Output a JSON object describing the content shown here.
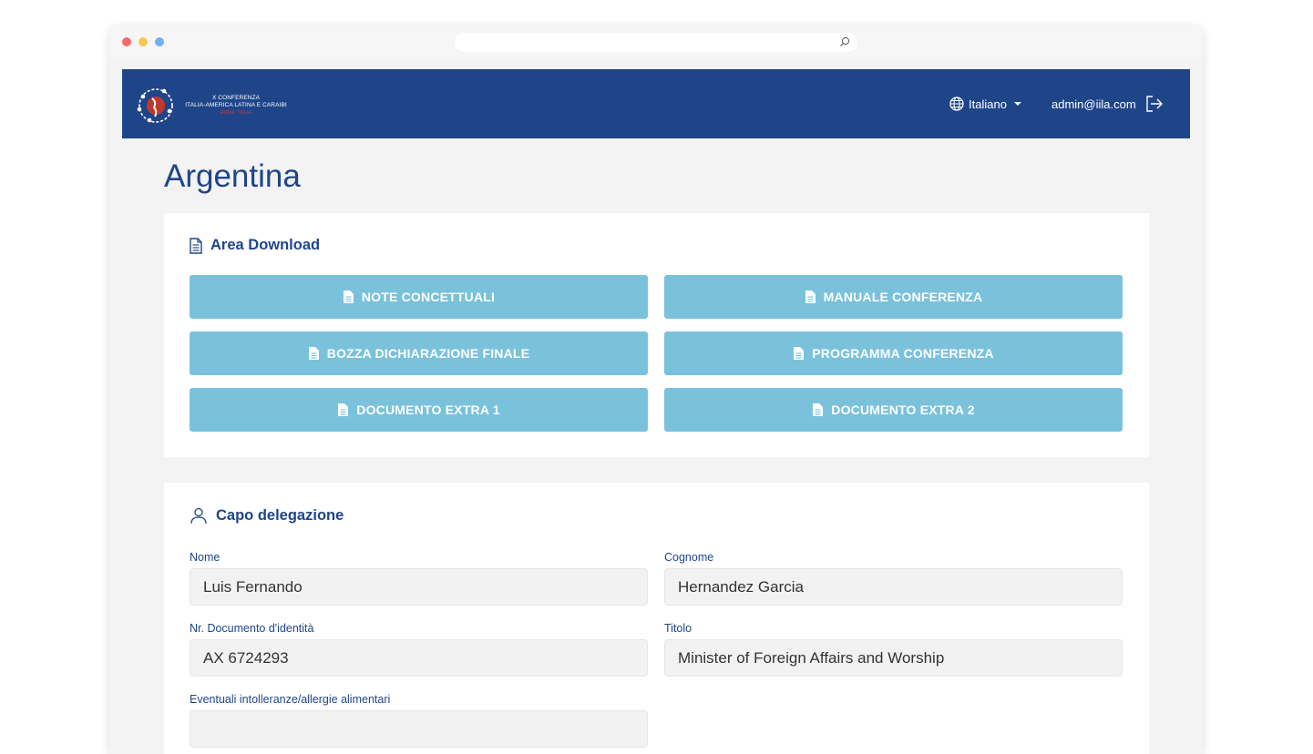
{
  "header": {
    "logo_lines": [
      "X CONFERENZA",
      "ITALIA-AMERICA LATINA E CARAIBI"
    ],
    "logo_subline": "ROMA, ITALIA",
    "language": "Italiano",
    "user_email": "admin@iila.com"
  },
  "page": {
    "title": "Argentina"
  },
  "download": {
    "title": "Area Download",
    "buttons": [
      "NOTE CONCETTUALI",
      "MANUALE CONFERENZA",
      "BOZZA DICHIARAZIONE FINALE",
      "PROGRAMMA CONFERENZA",
      "DOCUMENTO EXTRA 1",
      "DOCUMENTO EXTRA 2"
    ]
  },
  "delegation": {
    "title": "Capo delegazione",
    "fields": [
      {
        "label": "Nome",
        "value": "Luis Fernando"
      },
      {
        "label": "Cognome",
        "value": "Hernandez Garcia"
      },
      {
        "label": "Nr. Documento d'identità",
        "value": "AX 6724293"
      },
      {
        "label": "Titolo",
        "value": "Minister of Foreign Affairs and Worship"
      },
      {
        "label": "Eventuali intolleranze/allergie alimentari",
        "value": ""
      }
    ]
  },
  "icons": {
    "browser": [
      "window-close-dot",
      "window-minimize-dot",
      "window-zoom-dot",
      "search-icon"
    ],
    "header": [
      "logo-globe-icon",
      "globe-icon",
      "caret-down-icon",
      "logout-icon"
    ],
    "download": "document-icon",
    "delegation": "user-icon"
  },
  "colors": {
    "primary": "#1f4589",
    "download_button": "#7ac2db",
    "input_bg": "#f2f2f2",
    "page_bg": "#f3f3f3"
  }
}
